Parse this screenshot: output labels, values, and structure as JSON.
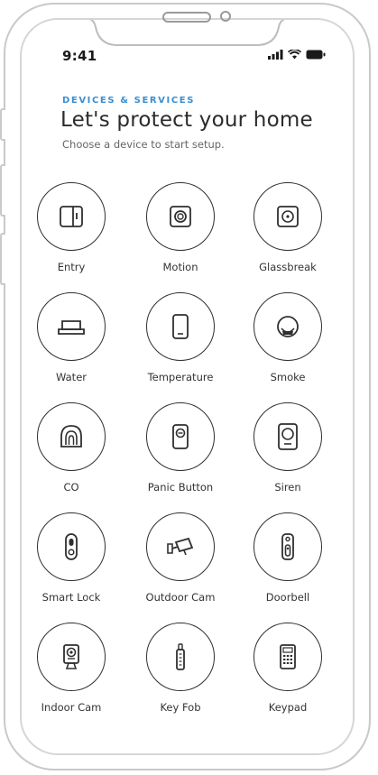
{
  "status_bar": {
    "time": "9:41"
  },
  "header": {
    "eyebrow": "DEVICES & SERVICES",
    "title": "Let's protect your home",
    "subtitle": "Choose a device to start setup."
  },
  "devices": [
    {
      "label": "Entry",
      "icon": "entry-sensor-icon"
    },
    {
      "label": "Motion",
      "icon": "motion-sensor-icon"
    },
    {
      "label": "Glassbreak",
      "icon": "glassbreak-sensor-icon"
    },
    {
      "label": "Water",
      "icon": "water-sensor-icon"
    },
    {
      "label": "Temperature",
      "icon": "temperature-sensor-icon"
    },
    {
      "label": "Smoke",
      "icon": "smoke-detector-icon"
    },
    {
      "label": "CO",
      "icon": "co-detector-icon"
    },
    {
      "label": "Panic Button",
      "icon": "panic-button-icon"
    },
    {
      "label": "Siren",
      "icon": "siren-icon"
    },
    {
      "label": "Smart Lock",
      "icon": "smart-lock-icon"
    },
    {
      "label": "Outdoor Cam",
      "icon": "outdoor-camera-icon"
    },
    {
      "label": "Doorbell",
      "icon": "doorbell-icon"
    },
    {
      "label": "Indoor Cam",
      "icon": "indoor-camera-icon"
    },
    {
      "label": "Key Fob",
      "icon": "key-fob-icon"
    },
    {
      "label": "Keypad",
      "icon": "keypad-icon"
    }
  ],
  "colors": {
    "accent": "#3a8fd1",
    "ink": "#2f2f2f"
  }
}
